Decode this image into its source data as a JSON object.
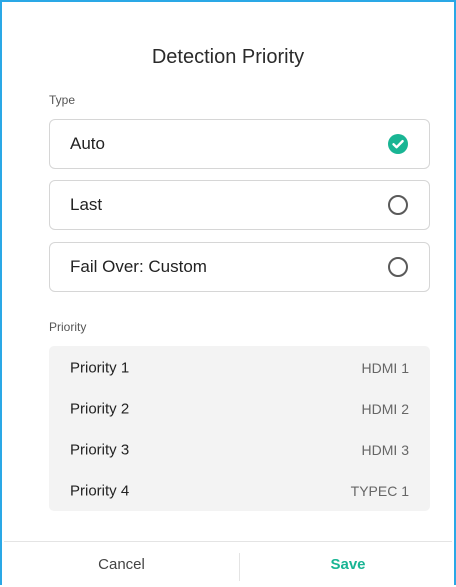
{
  "dialog": {
    "title": "Detection Priority",
    "type_label": "Type",
    "priority_label": "Priority"
  },
  "type_options": [
    {
      "label": "Auto",
      "selected": true
    },
    {
      "label": "Last",
      "selected": false
    },
    {
      "label": "Fail Over: Custom",
      "selected": false
    }
  ],
  "priorities": [
    {
      "name": "Priority 1",
      "value": "HDMI 1"
    },
    {
      "name": "Priority 2",
      "value": "HDMI 2"
    },
    {
      "name": "Priority 3",
      "value": "HDMI 3"
    },
    {
      "name": "Priority 4",
      "value": "TYPEC 1"
    }
  ],
  "footer": {
    "cancel_label": "Cancel",
    "save_label": "Save"
  },
  "colors": {
    "accent": "#19b594",
    "frame_border": "#2aa8e6",
    "priority_bg": "#f3f3f3"
  },
  "icons": {
    "selected": "check-circle-icon",
    "unselected": "radio-empty-icon"
  }
}
